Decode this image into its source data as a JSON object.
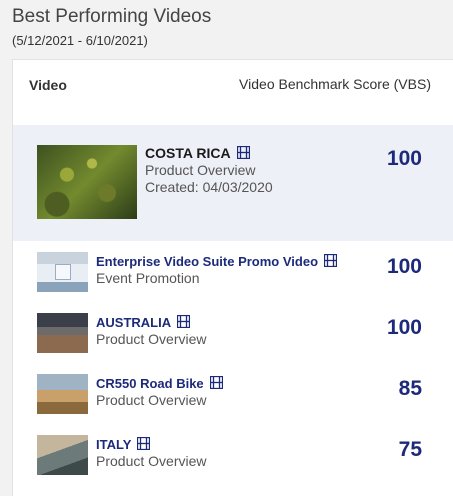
{
  "header": {
    "title": "Best Performing Videos",
    "date_range": "(5/12/2021 - 6/10/2021)"
  },
  "table": {
    "col_video": "Video",
    "col_score": "Video Benchmark Score (VBS)"
  },
  "featured": {
    "name": "COSTA RICA",
    "category": "Product Overview",
    "created": "Created: 04/03/2020",
    "score": "100",
    "thumbnail_icon": "film-icon"
  },
  "rows": [
    {
      "name": "Enterprise Video Suite Promo Video",
      "category": "Event Promotion",
      "score": "100"
    },
    {
      "name": "AUSTRALIA",
      "category": "Product Overview",
      "score": "100"
    },
    {
      "name": "CR550 Road Bike",
      "category": "Product Overview",
      "score": "85"
    },
    {
      "name": "ITALY",
      "category": "Product Overview",
      "score": "75"
    }
  ],
  "colors": {
    "accent": "#1d2a7a",
    "featured_bg": "#eef0f7"
  }
}
